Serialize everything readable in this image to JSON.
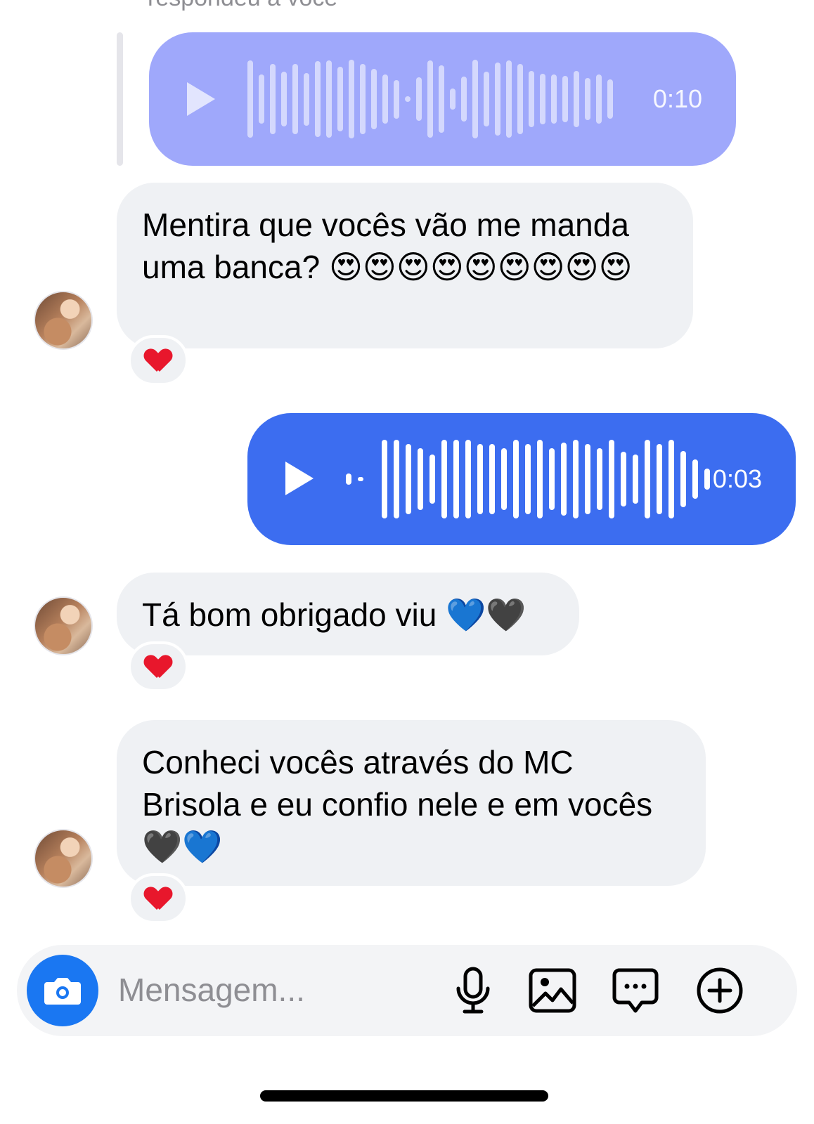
{
  "reply": {
    "caption": "respondeu a você"
  },
  "voice_quoted": {
    "duration": "0:10"
  },
  "voice_sent": {
    "duration": "0:03"
  },
  "messages": [
    {
      "text": "Mentira que vocês vão me manda uma banca? 😍😍😍😍😍😍😍😍😍",
      "reaction": "heart"
    },
    {
      "text": "Tá bom obrigado viu 💙🖤",
      "reaction": "heart"
    },
    {
      "text": "Conheci vocês através do MC Brisola e eu confio nele e em vocês 🖤💙",
      "reaction": "heart"
    }
  ],
  "composer": {
    "placeholder": "Mensagem...",
    "icons": [
      "camera-icon",
      "microphone-icon",
      "image-icon",
      "message-bubble-icon",
      "plus-circle-icon"
    ]
  },
  "colors": {
    "voice_quoted_bg": "#9fa8fb",
    "voice_sent_bg": "#3c6df0",
    "bubble_bg": "#eff1f4",
    "camera_button": "#1a77f2",
    "reaction_heart": "#e8172c"
  }
}
